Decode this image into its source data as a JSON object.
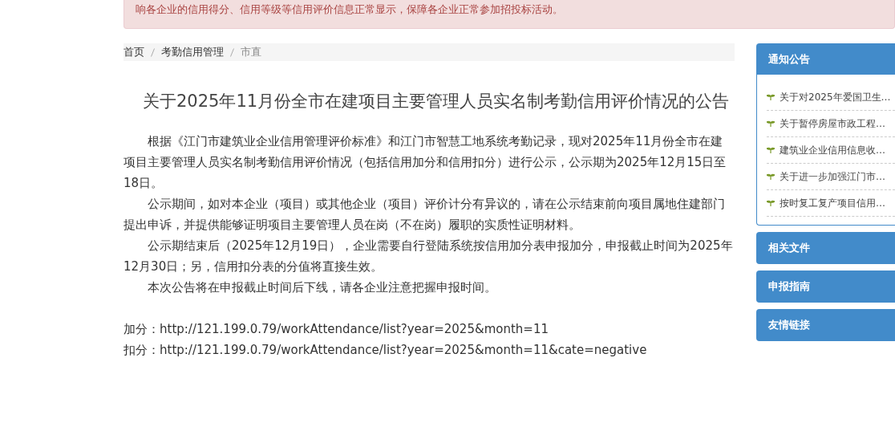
{
  "alert": {
    "text": "响各企业的信用得分、信用等级等信用评价信息正常显示，保障各企业正常参加招投标活动。"
  },
  "breadcrumb": [
    {
      "label": "首页",
      "current": false
    },
    {
      "label": "考勤信用管理",
      "current": false
    },
    {
      "label": "市直",
      "current": true
    }
  ],
  "article": {
    "title": "关于2025年11月份全市在建项目主要管理人员实名制考勤信用评价情况的公告",
    "paragraphs": [
      "根据《江门市建筑业企业信用管理评价标准》和江门市智慧工地系统考勤记录，现对2025年11月份全市在建项目主要管理人员实名制考勤信用评价情况（包括信用加分和信用扣分）进行公示，公示期为2025年12月15日至18日。",
      "公示期间，如对本企业（项目）或其他企业（项目）评价计分有异议的，请在公示结束前向项目属地住建部门提出申诉，并提供能够证明项目主要管理人员在岗（不在岗）履职的实质性证明材料。",
      "公示期结束后（2025年12月19日），企业需要自行登陆系统按信用加分表申报加分，申报截止时间为2025年12月30日；另，信用扣分表的分值将直接生效。",
      "本次公告将在申报截止时间后下线，请各企业注意把握申报时间。"
    ],
    "links": [
      "加分：http://121.199.0.79/workAttendance/list?year=2025&month=11",
      "扣分：http://121.199.0.79/workAttendance/list?year=2025&month=11&cate=negative"
    ]
  },
  "sidebar": [
    {
      "title": "通知公告",
      "items": [
        "关于对2025年爱国卫生…",
        "关于暂停房屋市政工程…",
        "建筑业企业信用信息收…",
        "关于进一步加强江门市…",
        "按时复工复产项目信用…"
      ]
    },
    {
      "title": "相关文件"
    },
    {
      "title": "申报指南"
    },
    {
      "title": "友情链接"
    }
  ]
}
